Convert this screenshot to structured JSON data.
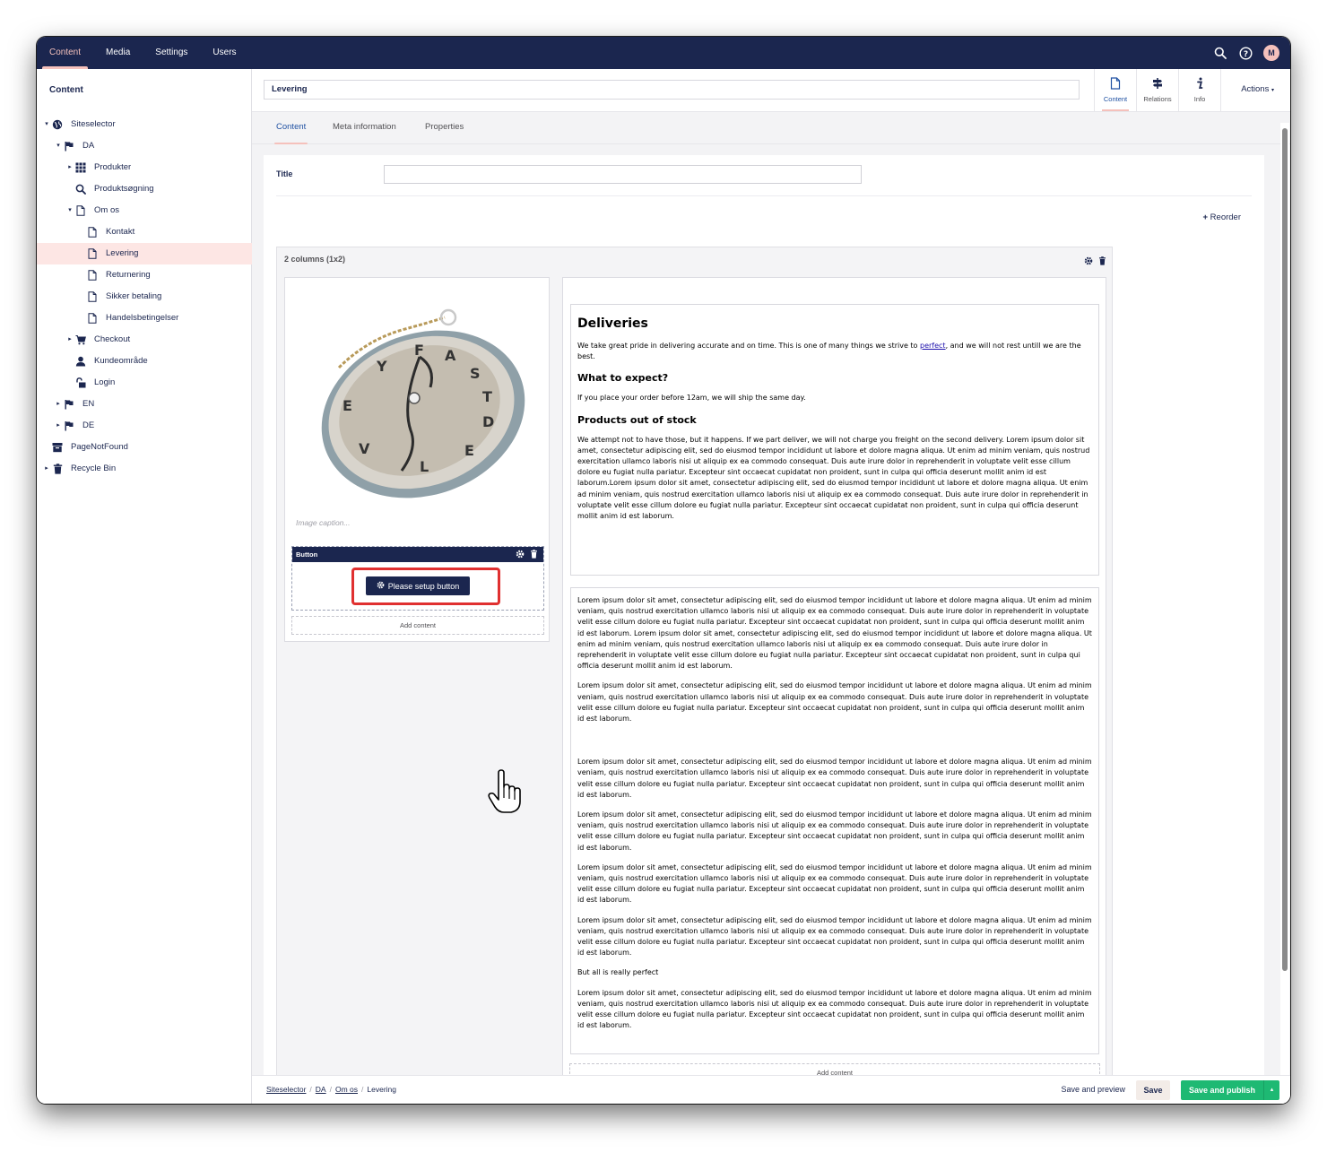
{
  "topnav": {
    "items": [
      {
        "label": "Content",
        "active": true
      },
      {
        "label": "Media",
        "active": false
      },
      {
        "label": "Settings",
        "active": false
      },
      {
        "label": "Users",
        "active": false
      }
    ],
    "avatar_initial": "M"
  },
  "sidebar": {
    "title": "Content",
    "tree": [
      {
        "label": "Siteselector",
        "icon": "globe-icon",
        "depth": 0,
        "caret": "down",
        "selected": false
      },
      {
        "label": "DA",
        "icon": "flag-icon",
        "depth": 1,
        "caret": "down",
        "selected": false
      },
      {
        "label": "Produkter",
        "icon": "grid-icon",
        "depth": 2,
        "caret": "right",
        "selected": false
      },
      {
        "label": "Produktsøgning",
        "icon": "search-icon",
        "depth": 2,
        "caret": "",
        "selected": false
      },
      {
        "label": "Om os",
        "icon": "document-icon",
        "depth": 2,
        "caret": "down",
        "selected": false
      },
      {
        "label": "Kontakt",
        "icon": "document-icon",
        "depth": 3,
        "caret": "",
        "selected": false
      },
      {
        "label": "Levering",
        "icon": "document-icon",
        "depth": 3,
        "caret": "",
        "selected": true
      },
      {
        "label": "Returnering",
        "icon": "document-icon",
        "depth": 3,
        "caret": "",
        "selected": false
      },
      {
        "label": "Sikker betaling",
        "icon": "document-icon",
        "depth": 3,
        "caret": "",
        "selected": false
      },
      {
        "label": "Handelsbetingelser",
        "icon": "document-icon",
        "depth": 3,
        "caret": "",
        "selected": false
      },
      {
        "label": "Checkout",
        "icon": "cart-icon",
        "depth": 2,
        "caret": "right",
        "selected": false
      },
      {
        "label": "Kundeområde",
        "icon": "user-icon",
        "depth": 2,
        "caret": "",
        "selected": false
      },
      {
        "label": "Login",
        "icon": "unlock-icon",
        "depth": 2,
        "caret": "",
        "selected": false
      },
      {
        "label": "EN",
        "icon": "flag-icon",
        "depth": 1,
        "caret": "right",
        "selected": false
      },
      {
        "label": "DE",
        "icon": "flag-icon",
        "depth": 1,
        "caret": "right",
        "selected": false
      },
      {
        "label": "PageNotFound",
        "icon": "archive-icon",
        "depth": 0,
        "caret": "",
        "selected": false
      },
      {
        "label": "Recycle Bin",
        "icon": "trash-icon",
        "depth": 0,
        "caret": "right",
        "selected": false
      }
    ]
  },
  "header": {
    "node_name": "Levering",
    "apps": [
      {
        "label": "Content",
        "icon": "document-icon",
        "active": true
      },
      {
        "label": "Relations",
        "icon": "signpost-icon",
        "active": false
      },
      {
        "label": "Info",
        "icon": "info-icon",
        "active": false
      }
    ],
    "actions_label": "Actions"
  },
  "tabs": [
    {
      "label": "Content",
      "active": true
    },
    {
      "label": "Meta information",
      "active": false
    },
    {
      "label": "Properties",
      "active": false
    }
  ],
  "editor": {
    "title_label": "Title",
    "title_value": "",
    "reorder_label": "Reorder",
    "grid_title": "2 columns (1x2)",
    "image_caption_placeholder": "Image caption...",
    "button_block_label": "Button",
    "setup_button_label": "Please setup button",
    "add_content_label": "Add content",
    "rte1": {
      "heading": "Deliveries",
      "intro_before": "We take great pride in delivering accurate and on time. This is one of many things we strive to ",
      "intro_link": "perfect",
      "intro_after": ", and we will not rest untill we are the best.",
      "h2_expect": "What to expect?",
      "expect_text": "If you place your order before 12am, we will ship the same day.",
      "h2_stock": "Products out of stock",
      "stock_text": "We attempt not to have those, but it happens. If we part deliver, we will not charge you freight on the second delivery. Lorem ipsum dolor sit amet, consectetur adipiscing elit, sed do eiusmod tempor incididunt ut labore et dolore magna aliqua. Ut enim ad minim veniam, quis nostrud exercitation ullamco laboris nisi ut aliquip ex ea commodo consequat. Duis aute irure dolor in reprehenderit in voluptate velit esse cillum dolore eu fugiat nulla pariatur. Excepteur sint occaecat cupidatat non proident, sunt in culpa qui officia deserunt mollit anim id est laborum.Lorem ipsum dolor sit amet, consectetur adipiscing elit, sed do eiusmod tempor incididunt ut labore et dolore magna aliqua. Ut enim ad minim veniam, quis nostrud exercitation ullamco laboris nisi ut aliquip ex ea commodo consequat. Duis aute irure dolor in reprehenderit in voluptate velit esse cillum dolore eu fugiat nulla pariatur. Excepteur sint occaecat cupidatat non proident, sunt in culpa qui officia deserunt mollit anim id est laborum."
    },
    "rte2": {
      "p1": "Lorem ipsum dolor sit amet, consectetur adipiscing elit, sed do eiusmod tempor incididunt ut labore et dolore magna aliqua. Ut enim ad minim veniam, quis nostrud exercitation ullamco laboris nisi ut aliquip ex ea commodo consequat. Duis aute irure dolor in reprehenderit in voluptate velit esse cillum dolore eu fugiat nulla pariatur. Excepteur sint occaecat cupidatat non proident, sunt in culpa qui officia deserunt mollit anim id est laborum. Lorem ipsum dolor sit amet, consectetur adipiscing elit, sed do eiusmod tempor incididunt ut labore et dolore magna aliqua. Ut enim ad minim veniam, quis nostrud exercitation ullamco laboris nisi ut aliquip ex ea commodo consequat. Duis aute irure dolor in reprehenderit in voluptate velit esse cillum dolore eu fugiat nulla pariatur. Excepteur sint occaecat cupidatat non proident, sunt in culpa qui officia deserunt mollit anim id est laborum.",
      "p2": "Lorem ipsum dolor sit amet, consectetur adipiscing elit, sed do eiusmod tempor incididunt ut labore et dolore magna aliqua. Ut enim ad minim veniam, quis nostrud exercitation ullamco laboris nisi ut aliquip ex ea commodo consequat. Duis aute irure dolor in reprehenderit in voluptate velit esse cillum dolore eu fugiat nulla pariatur. Excepteur sint occaecat cupidatat non proident, sunt in culpa qui officia deserunt mollit anim id est laborum.",
      "p3": "Lorem ipsum dolor sit amet, consectetur adipiscing elit, sed do eiusmod tempor incididunt ut labore et dolore magna aliqua. Ut enim ad minim veniam, quis nostrud exercitation ullamco laboris nisi ut aliquip ex ea commodo consequat. Duis aute irure dolor in reprehenderit in voluptate velit esse cillum dolore eu fugiat nulla pariatur. Excepteur sint occaecat cupidatat non proident, sunt in culpa qui officia deserunt mollit anim id est laborum.",
      "p4": "Lorem ipsum dolor sit amet, consectetur adipiscing elit, sed do eiusmod tempor incididunt ut labore et dolore magna aliqua. Ut enim ad minim veniam, quis nostrud exercitation ullamco laboris nisi ut aliquip ex ea commodo consequat. Duis aute irure dolor in reprehenderit in voluptate velit esse cillum dolore eu fugiat nulla pariatur. Excepteur sint occaecat cupidatat non proident, sunt in culpa qui officia deserunt mollit anim id est laborum.",
      "p5": "Lorem ipsum dolor sit amet, consectetur adipiscing elit, sed do eiusmod tempor incididunt ut labore et dolore magna aliqua. Ut enim ad minim veniam, quis nostrud exercitation ullamco laboris nisi ut aliquip ex ea commodo consequat. Duis aute irure dolor in reprehenderit in voluptate velit esse cillum dolore eu fugiat nulla pariatur. Excepteur sint occaecat cupidatat non proident, sunt in culpa qui officia deserunt mollit anim id est laborum.",
      "p6": "Lorem ipsum dolor sit amet, consectetur adipiscing elit, sed do eiusmod tempor incididunt ut labore et dolore magna aliqua. Ut enim ad minim veniam, quis nostrud exercitation ullamco laboris nisi ut aliquip ex ea commodo consequat. Duis aute irure dolor in reprehenderit in voluptate velit esse cillum dolore eu fugiat nulla pariatur. Excepteur sint occaecat cupidatat non proident, sunt in culpa qui officia deserunt mollit anim id est laborum.",
      "p7": "But all is really perfect",
      "p8": "Lorem ipsum dolor sit amet, consectetur adipiscing elit, sed do eiusmod tempor incididunt ut labore et dolore magna aliqua. Ut enim ad minim veniam, quis nostrud exercitation ullamco laboris nisi ut aliquip ex ea commodo consequat. Duis aute irure dolor in reprehenderit in voluptate velit esse cillum dolore eu fugiat nulla pariatur. Excepteur sint occaecat cupidatat non proident, sunt in culpa qui officia deserunt mollit anim id est laborum."
    }
  },
  "footer": {
    "breadcrumb": [
      "Siteselector",
      "DA",
      "Om os",
      "Levering"
    ],
    "save_preview_label": "Save and preview",
    "save_label": "Save",
    "publish_label": "Save and publish"
  },
  "colors": {
    "primary": "#1b264f",
    "accent": "#f5c1bc",
    "publish": "#1eb973",
    "highlight": "#e03030"
  }
}
